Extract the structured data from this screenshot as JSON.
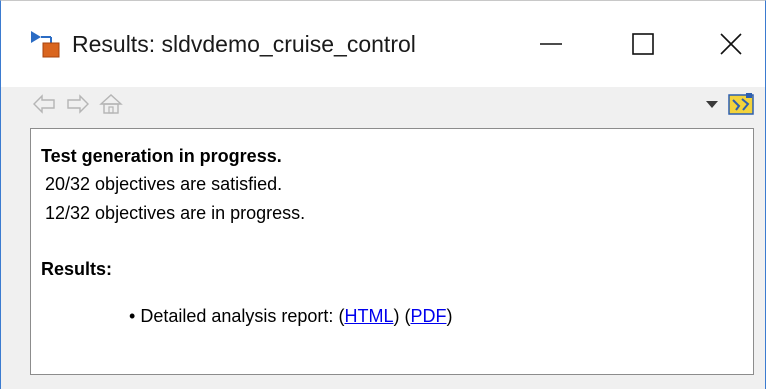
{
  "window": {
    "title": "Results: sldvdemo_cruise_control"
  },
  "titlebar": {
    "app_icon": "simulink-design-verifier-icon",
    "minimize_icon": "minimize-icon",
    "maximize_icon": "maximize-icon",
    "close_icon": "close-icon"
  },
  "toolbar": {
    "back_icon": "back-arrow-icon",
    "forward_icon": "forward-arrow-icon",
    "home_icon": "home-icon",
    "dropdown_icon": "chevron-down-icon",
    "options_icon": "sldv-highlight-icon"
  },
  "report": {
    "status_heading": "Test generation in progress.",
    "satisfied_line": "20/32 objectives are satisfied.",
    "in_progress_line": "12/32 objectives are in progress.",
    "results_heading": "Results:",
    "bullet": "•",
    "detail_label": "Detailed analysis report:",
    "open_paren_1": "(",
    "html_link": "HTML",
    "close_paren_1": ")",
    "open_paren_2": "(",
    "pdf_link": "PDF",
    "close_paren_2": ")"
  }
}
